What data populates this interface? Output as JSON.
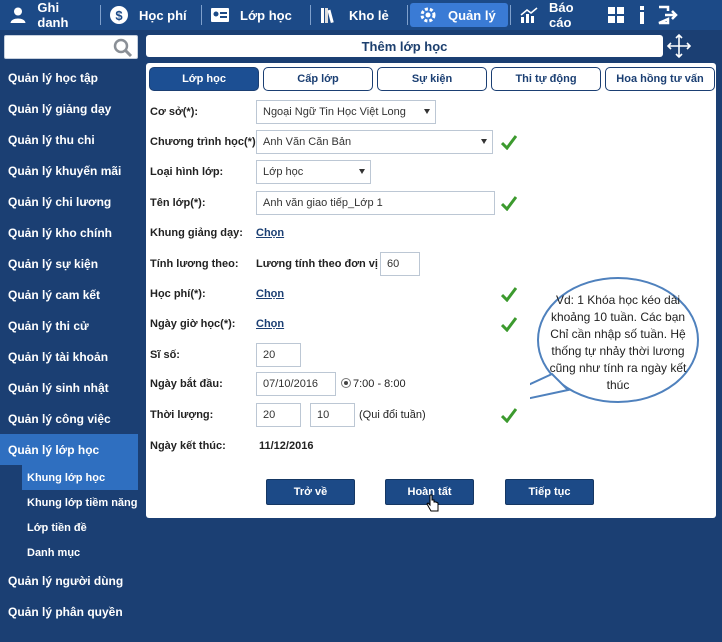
{
  "topnav": [
    {
      "label": "Ghi danh",
      "icon": "user-icon",
      "active": false
    },
    {
      "label": "Học phí",
      "icon": "dollar-icon",
      "active": false
    },
    {
      "label": "Lớp học",
      "icon": "id-card-icon",
      "active": false
    },
    {
      "label": "Kho lẻ",
      "icon": "books-icon",
      "active": false
    },
    {
      "label": "Quản lý",
      "icon": "gear-icon",
      "active": true
    },
    {
      "label": "Báo cáo",
      "icon": "chart-icon",
      "active": false
    }
  ],
  "search": {
    "value": ""
  },
  "sidebar": {
    "items": [
      {
        "label": "Quản lý học tập"
      },
      {
        "label": "Quản lý giảng dạy"
      },
      {
        "label": "Quản lý thu chi"
      },
      {
        "label": "Quản lý khuyến mãi"
      },
      {
        "label": "Quản lý chi lương"
      },
      {
        "label": "Quản lý kho chính"
      },
      {
        "label": "Quản lý sự kiện"
      },
      {
        "label": "Quản lý cam kết"
      },
      {
        "label": "Quản lý thi cử"
      },
      {
        "label": "Quản lý tài khoản"
      },
      {
        "label": "Quản lý sinh nhật"
      },
      {
        "label": "Quản lý công việc"
      },
      {
        "label": "Quản lý lớp học"
      }
    ],
    "subitems": [
      {
        "label": "Khung lớp học"
      },
      {
        "label": "Khung lớp tiềm năng"
      },
      {
        "label": "Lớp tiền đề"
      },
      {
        "label": "Danh mục"
      }
    ],
    "items_after": [
      {
        "label": "Quản lý người dùng"
      },
      {
        "label": "Quản lý phân quyền"
      }
    ]
  },
  "header": {
    "title": "Thêm lớp học"
  },
  "tabs": [
    {
      "label": "Lớp học",
      "active": true
    },
    {
      "label": "Cấp lớp",
      "active": false
    },
    {
      "label": "Sự kiện",
      "active": false
    },
    {
      "label": "Thi tự động",
      "active": false
    },
    {
      "label": "Hoa hồng tư vấn",
      "active": false
    }
  ],
  "form": {
    "co_so": {
      "label": "Cơ sở(*):",
      "value": "Ngoại Ngữ Tin Học Việt Long"
    },
    "chuong_trinh": {
      "label": "Chương trình học(*):",
      "value": "Anh Văn Căn Bản"
    },
    "loai_hinh": {
      "label": "Loại hình lớp:",
      "value": "Lớp học"
    },
    "ten_lop": {
      "label": "Tên lớp(*):",
      "value": "Anh văn giao tiếp_Lớp 1"
    },
    "khung_giang_day": {
      "label": "Khung giảng dạy:",
      "link": "Chọn"
    },
    "tinh_luong": {
      "label": "Tính lương theo:",
      "text": "Lương tính theo đơn vị",
      "value": "60"
    },
    "hoc_phi": {
      "label": "Học phí(*):",
      "link": "Chọn"
    },
    "ngay_gio_hoc": {
      "label": "Ngày giờ học(*):",
      "link": "Chọn"
    },
    "si_so": {
      "label": "Sĩ số:",
      "value": "20"
    },
    "ngay_bat_dau": {
      "label": "Ngày bắt đầu:",
      "value": "07/10/2016",
      "time": "7:00 - 8:00"
    },
    "thoi_luong": {
      "label": "Thời lượng:",
      "value1": "20",
      "value2": "10",
      "note": "(Qui đổi tuần)"
    },
    "ngay_ket_thuc": {
      "label": "Ngày kết thúc:",
      "value": "11/12/2016"
    }
  },
  "buttons": {
    "back": "Trở về",
    "done": "Hoàn tất",
    "next": "Tiếp tục"
  },
  "callout": {
    "text": "Vd: 1 Khóa học kéo dài khoảng 10 tuần. Các bạn Chỉ cần nhập số tuần. Hệ thống tự nhảy thời lương cũng như tính ra ngày kết thúc"
  },
  "colors": {
    "navy": "#1b3f73",
    "accent": "#2f6fc0",
    "check": "#3c9a2e",
    "callout_border": "#4f81bd"
  }
}
